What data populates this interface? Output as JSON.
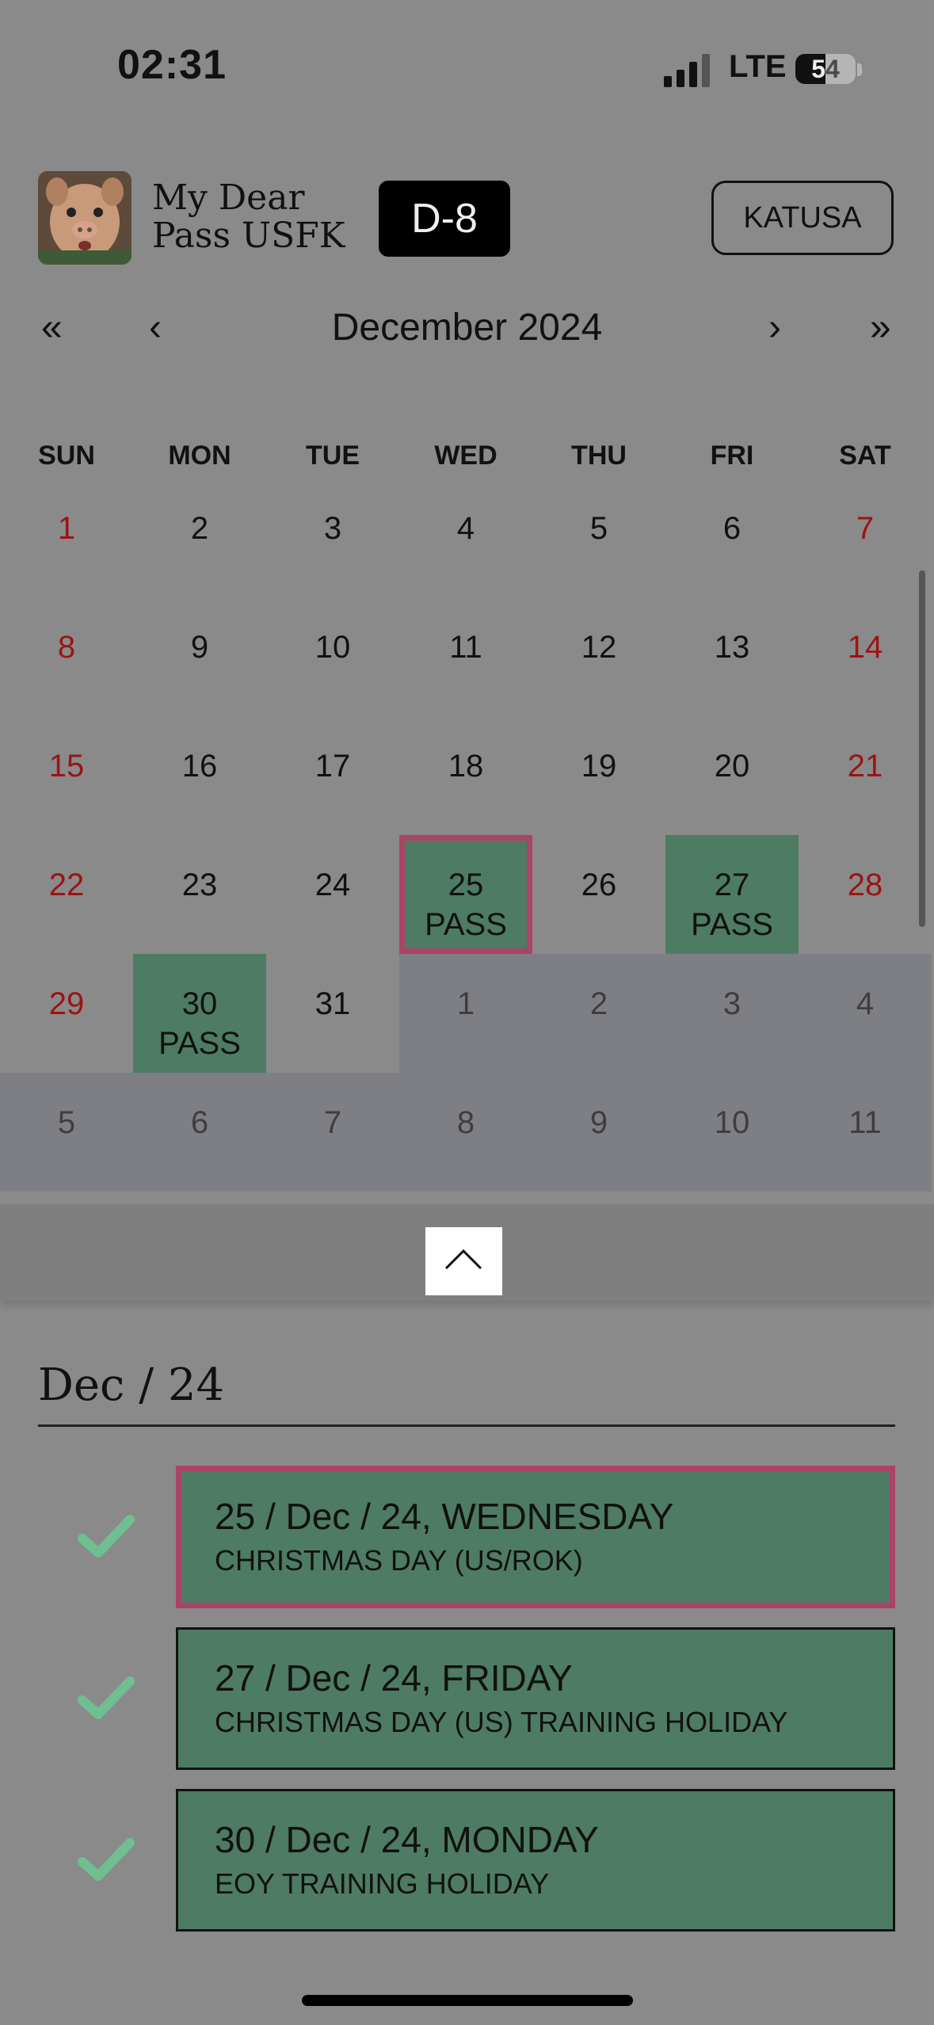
{
  "status": {
    "time": "02:31",
    "network": "LTE",
    "battery": "54"
  },
  "header": {
    "title_line1": "My Dear",
    "title_line2": "Pass USFK",
    "dday": "D-8",
    "mode_button": "KATUSA"
  },
  "calendar": {
    "month_label": "December 2024",
    "nav": {
      "prev_year": "«",
      "prev_month": "‹",
      "next_month": "›",
      "next_year": "»"
    },
    "weekdays": [
      "SUN",
      "MON",
      "TUE",
      "WED",
      "THU",
      "FRI",
      "SAT"
    ],
    "weeks": [
      [
        {
          "d": "1"
        },
        {
          "d": "2"
        },
        {
          "d": "3"
        },
        {
          "d": "4"
        },
        {
          "d": "5"
        },
        {
          "d": "6"
        },
        {
          "d": "7"
        }
      ],
      [
        {
          "d": "8"
        },
        {
          "d": "9"
        },
        {
          "d": "10"
        },
        {
          "d": "11"
        },
        {
          "d": "12"
        },
        {
          "d": "13"
        },
        {
          "d": "14"
        }
      ],
      [
        {
          "d": "15"
        },
        {
          "d": "16"
        },
        {
          "d": "17"
        },
        {
          "d": "18"
        },
        {
          "d": "19"
        },
        {
          "d": "20"
        },
        {
          "d": "21"
        }
      ],
      [
        {
          "d": "22"
        },
        {
          "d": "23"
        },
        {
          "d": "24"
        },
        {
          "d": "25",
          "tag": "PASS",
          "selected": true
        },
        {
          "d": "26"
        },
        {
          "d": "27",
          "tag": "PASS"
        },
        {
          "d": "28"
        }
      ],
      [
        {
          "d": "29"
        },
        {
          "d": "30",
          "tag": "PASS"
        },
        {
          "d": "31"
        },
        {
          "d": "1",
          "outside": true
        },
        {
          "d": "2",
          "outside": true
        },
        {
          "d": "3",
          "outside": true
        },
        {
          "d": "4",
          "outside": true
        }
      ],
      [
        {
          "d": "5",
          "outside": true
        },
        {
          "d": "6",
          "outside": true
        },
        {
          "d": "7",
          "outside": true
        },
        {
          "d": "8",
          "outside": true
        },
        {
          "d": "9",
          "outside": true
        },
        {
          "d": "10",
          "outside": true
        },
        {
          "d": "11",
          "outside": true
        }
      ]
    ]
  },
  "list": {
    "title": "Dec / 24",
    "items": [
      {
        "date": "25 / Dec / 24, WEDNESDAY",
        "description": "CHRISTMAS DAY (US/ROK)",
        "selected": true
      },
      {
        "date": "27 / Dec / 24, FRIDAY",
        "description": "CHRISTMAS DAY (US) TRAINING HOLIDAY",
        "selected": false
      },
      {
        "date": "30 / Dec / 24, MONDAY",
        "description": "EOY TRAINING HOLIDAY",
        "selected": false
      }
    ]
  },
  "colors": {
    "pass": "#4e7b64",
    "selected_border": "#a94466",
    "weekend": "#9b1414",
    "check": "#6fbf90"
  }
}
